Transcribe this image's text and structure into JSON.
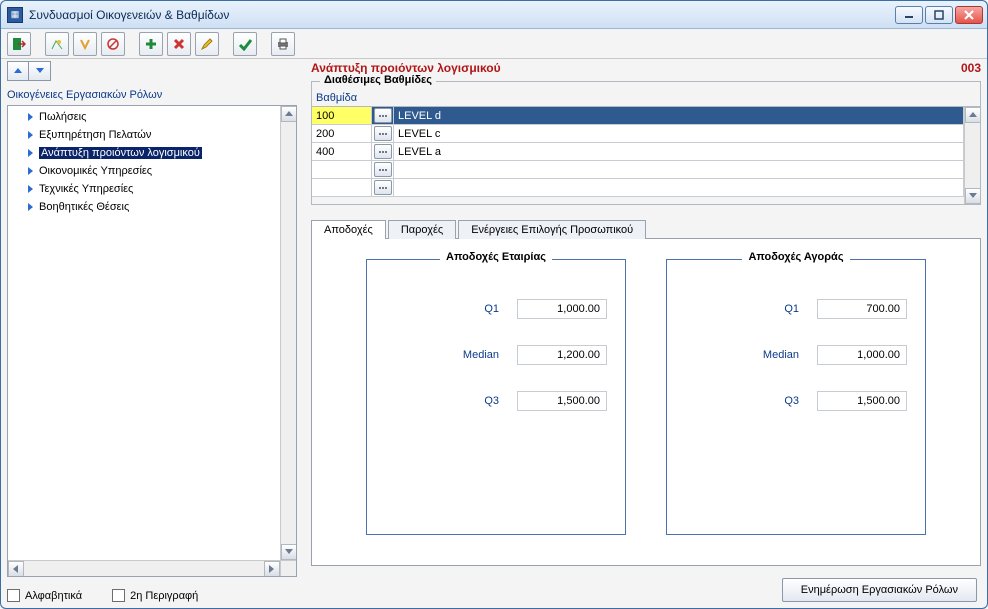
{
  "window": {
    "title": "Συνδυασμοί Οικογενειών & Βαθμίδων"
  },
  "tree": {
    "header": "Οικογένειες Εργασιακών Ρόλων",
    "items": [
      {
        "label": "Πωλήσεις",
        "selected": false
      },
      {
        "label": "Εξυπηρέτηση Πελατών",
        "selected": false
      },
      {
        "label": "Ανάπτυξη προιόντων λογισμικού",
        "selected": true
      },
      {
        "label": "Οικονομικές Υπηρεσίες",
        "selected": false
      },
      {
        "label": "Τεχνικές Υπηρεσίες",
        "selected": false
      },
      {
        "label": "Βοηθητικές Θέσεις",
        "selected": false
      }
    ]
  },
  "checks": {
    "alpha": "Αλφαβητικά",
    "desc2": "2η Περιγραφή"
  },
  "selection": {
    "title": "Ανάπτυξη προιόντων λογισμικού",
    "code": "003"
  },
  "grid": {
    "group_title": "Διαθέσιμες Βαθμίδες",
    "header": "Βαθμίδα",
    "rows": [
      {
        "code": "100",
        "desc": "LEVEL d",
        "selected": true
      },
      {
        "code": "200",
        "desc": "LEVEL c",
        "selected": false
      },
      {
        "code": "400",
        "desc": "LEVEL a",
        "selected": false
      },
      {
        "code": "",
        "desc": "",
        "selected": false
      },
      {
        "code": "",
        "desc": "",
        "selected": false
      }
    ]
  },
  "tabs": {
    "t1": "Αποδοχές",
    "t2": "Παροχές",
    "t3": "Ενέργειες Επιλογής Προσωπικού"
  },
  "stats": {
    "company_title": "Αποδοχές Εταιρίας",
    "market_title": "Αποδοχές Αγοράς",
    "labels": {
      "q1": "Q1",
      "median": "Median",
      "q3": "Q3"
    },
    "company": {
      "q1": "1,000.00",
      "median": "1,200.00",
      "q3": "1,500.00"
    },
    "market": {
      "q1": "700.00",
      "median": "1,000.00",
      "q3": "1,500.00"
    }
  },
  "footer": {
    "update_btn": "Ενημέρωση Εργασιακών Ρόλων"
  }
}
